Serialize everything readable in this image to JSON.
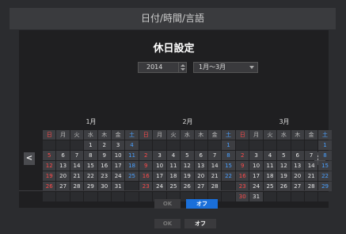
{
  "window": {
    "title": "日付/時間/言語"
  },
  "dialog": {
    "title": "休日設定",
    "year": "2014",
    "month_range": "1月～3月",
    "ok_label": "OK",
    "off_label": "オフ",
    "nav_prev": "<",
    "nav_next": ">"
  },
  "footer": {
    "ok_label": "OK",
    "off_label": "オフ"
  },
  "weekdays": [
    "日",
    "月",
    "火",
    "水",
    "木",
    "金",
    "土"
  ],
  "calendars": [
    {
      "title": "1月",
      "offset": 3,
      "days": 31
    },
    {
      "title": "2月",
      "offset": 6,
      "days": 28
    },
    {
      "title": "3月",
      "offset": 6,
      "days": 31
    }
  ],
  "colors": {
    "sunday": "#ff4b4b",
    "saturday": "#4aa0ff",
    "accent": "#1a6fd9"
  }
}
